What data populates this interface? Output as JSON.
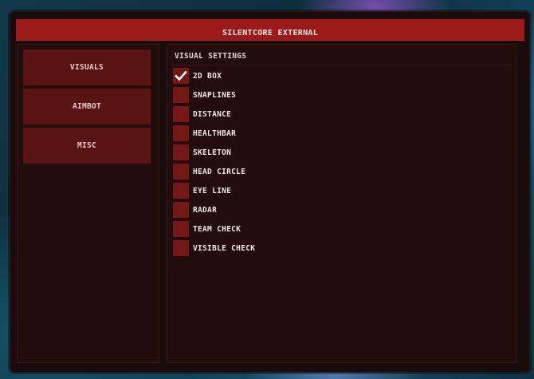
{
  "window": {
    "title": "SILENTCORE EXTERNAL"
  },
  "sidebar": {
    "tabs": [
      {
        "label": "VISUALS"
      },
      {
        "label": "AIMBOT"
      },
      {
        "label": "MISC"
      }
    ]
  },
  "main": {
    "section_title": "VISUAL SETTINGS",
    "options": [
      {
        "label": "2D BOX",
        "checked": true
      },
      {
        "label": "SNAPLINES",
        "checked": false
      },
      {
        "label": "DISTANCE",
        "checked": false
      },
      {
        "label": "HEALTHBAR",
        "checked": false
      },
      {
        "label": "SKELETON",
        "checked": false
      },
      {
        "label": "HEAD CIRCLE",
        "checked": false
      },
      {
        "label": "EYE LINE",
        "checked": false
      },
      {
        "label": "RADAR",
        "checked": false
      },
      {
        "label": "TEAM CHECK",
        "checked": false
      },
      {
        "label": "VISIBLE CHECK",
        "checked": false
      }
    ]
  },
  "icons": {
    "check": "checkmark-icon"
  },
  "colors": {
    "accent": "#9b1b1b",
    "checkbox": "#741717",
    "tab": "#5b1414",
    "panel": "#220c0c",
    "window": "#1a0c0c"
  }
}
